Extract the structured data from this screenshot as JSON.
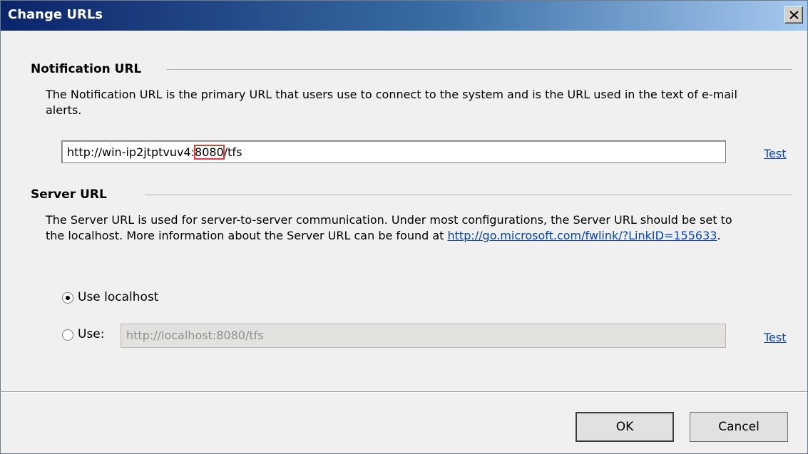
{
  "window": {
    "title": "Change URLs",
    "close_label": "×"
  },
  "notification": {
    "heading": "Notification URL",
    "description": "The Notification URL is the primary URL that users use to connect to the system and is the URL used in the text of e-mail alerts.",
    "url_prefix": "http://win-ip2jtptvuv4:",
    "url_port": "8080",
    "url_suffix": "/tfs",
    "test_label": "Test"
  },
  "server": {
    "heading": "Server URL",
    "description": "The Server URL is used for server-to-server communication. Under most configurations, the Server URL should be set to the localhost. More information about the Server URL can be found at ",
    "link_text": "http://go.microsoft.com/fwlink/?LinkID=155633",
    "description_end": ".",
    "option_localhost_label": "Use localhost",
    "option_use_label": "Use:",
    "use_url_value": "http://localhost:8080/tfs",
    "test_label": "Test",
    "selected_option": "localhost"
  },
  "buttons": {
    "ok_label": "OK",
    "cancel_label": "Cancel"
  },
  "colors": {
    "highlight": "#e83c3c",
    "link": "#0645ad"
  }
}
